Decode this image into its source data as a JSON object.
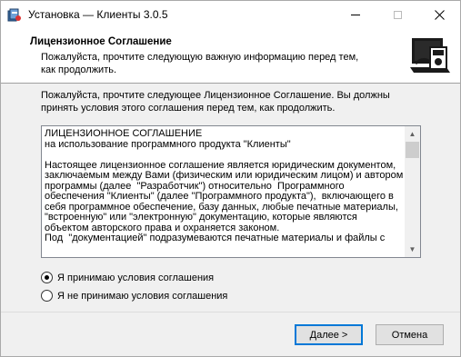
{
  "window": {
    "title": "Установка — Клиенты 3.0.5",
    "minimize_icon": "minimize-icon",
    "maximize_icon": "maximize-icon",
    "close_icon": "close-icon"
  },
  "header": {
    "title": "Лицензионное Соглашение",
    "subtitle": "Пожалуйста, прочтите следующую важную информацию перед тем, как продолжить."
  },
  "body": {
    "intro": "Пожалуйста, прочтите следующее Лицензионное Соглашение. Вы должны принять условия этого соглашения перед тем, как продолжить.",
    "license_text": "ЛИЦЕНЗИОННОЕ СОГЛАШЕНИЕ\nна использование программного продукта \"Клиенты\"\n\nНастоящее лицензионное соглашение является юридическим документом, заключаемым между Вами (физическим или юридическим лицом) и автором программы (далее  \"Разработчик\") относительно  Программного обеспечения \"Клиенты\" (далее \"Программного продукта\"),  включающего в себя программное обеспечение, базу данных, любые печатные материалы, \"встроенную\" или \"электронную\" документацию, которые являются объектом авторского права и охраняется законом.\nПод  \"документацией\" подразумеваются печатные материалы и файлы с",
    "accept_label": "Я принимаю условия соглашения",
    "reject_label": "Я не принимаю условия соглашения",
    "selected": "accept"
  },
  "buttons": {
    "next": "Далее >",
    "cancel": "Отмена"
  },
  "colors": {
    "accent": "#0078d7"
  }
}
